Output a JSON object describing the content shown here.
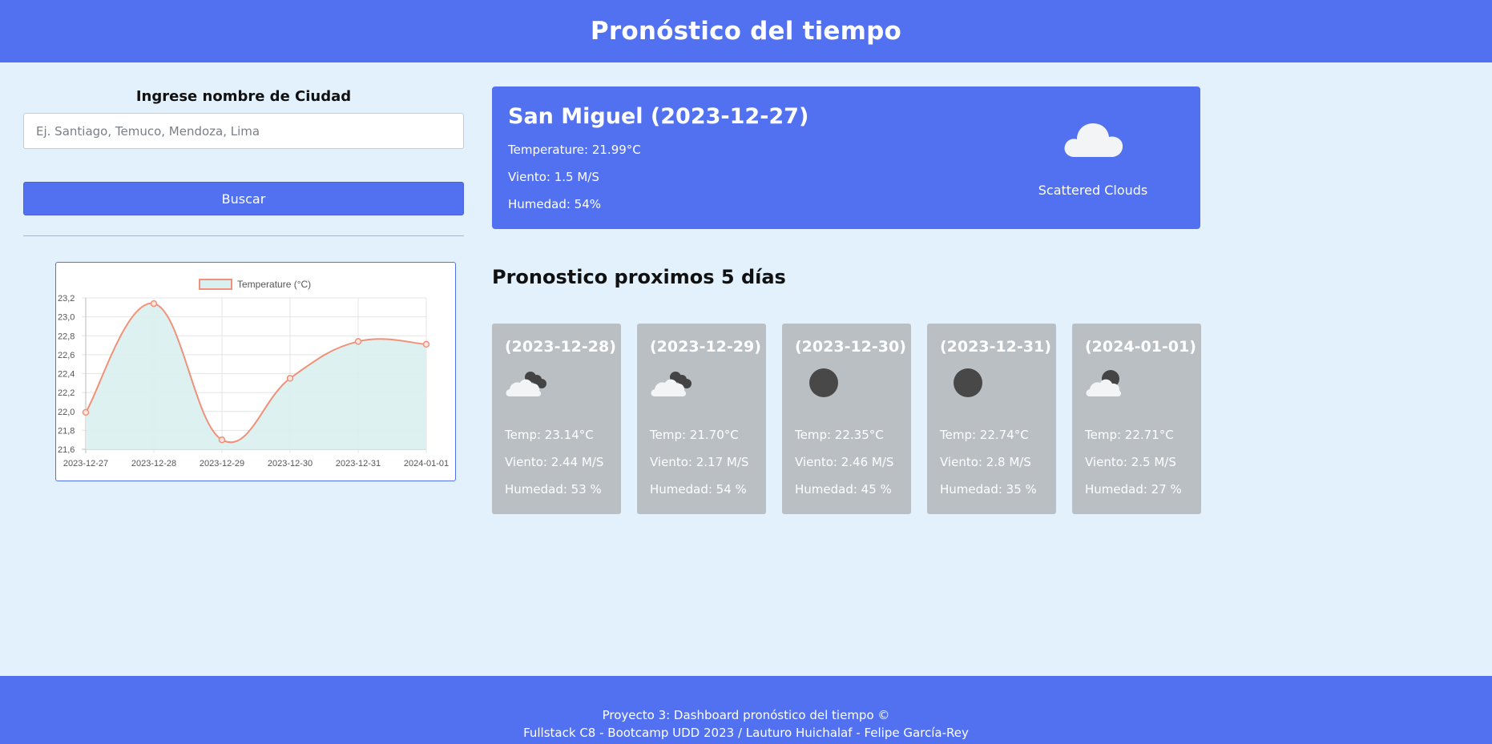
{
  "header": {
    "title": "Pronóstico del tiempo"
  },
  "search": {
    "label": "Ingrese nombre de Ciudad",
    "placeholder": "Ej. Santiago, Temuco, Mendoza, Lima",
    "button_label": "Buscar"
  },
  "current": {
    "title": "San Miguel (2023-12-27)",
    "temperature": "Temperature: 21.99°C",
    "wind": "Viento: 1.5 M/S",
    "humidity": "Humedad: 54%",
    "description": "Scattered Clouds",
    "icon": "cloud-icon"
  },
  "forecast": {
    "title": "Pronostico proximos 5 días",
    "days": [
      {
        "date": "(2023-12-28)",
        "icon": "cloud-night-icon",
        "temp": "Temp: 23.14°C",
        "wind": "Viento: 2.44 M/S",
        "humidity": "Humedad: 53 %"
      },
      {
        "date": "(2023-12-29)",
        "icon": "cloud-night-icon",
        "temp": "Temp: 21.70°C",
        "wind": "Viento: 2.17 M/S",
        "humidity": "Humedad: 54 %"
      },
      {
        "date": "(2023-12-30)",
        "icon": "moon-icon",
        "temp": "Temp: 22.35°C",
        "wind": "Viento: 2.46 M/S",
        "humidity": "Humedad: 45 %"
      },
      {
        "date": "(2023-12-31)",
        "icon": "moon-icon",
        "temp": "Temp: 22.74°C",
        "wind": "Viento: 2.8 M/S",
        "humidity": "Humedad: 35 %"
      },
      {
        "date": "(2024-01-01)",
        "icon": "cloud-moon-icon",
        "temp": "Temp: 22.71°C",
        "wind": "Viento: 2.5 M/S",
        "humidity": "Humedad: 27 %"
      }
    ]
  },
  "chart_data": {
    "type": "line",
    "title": "",
    "xlabel": "",
    "ylabel": "",
    "categories": [
      "2023-12-27",
      "2023-12-28",
      "2023-12-29",
      "2023-12-30",
      "2023-12-31",
      "2024-01-01"
    ],
    "series": [
      {
        "name": "Temperature (°C)",
        "values": [
          21.99,
          23.14,
          21.7,
          22.35,
          22.74,
          22.71
        ]
      }
    ],
    "ylim": [
      21.6,
      23.2
    ],
    "yticks": [
      "21,6",
      "21,8",
      "22,0",
      "22,2",
      "22,4",
      "22,6",
      "22,8",
      "23,0",
      "23,2"
    ],
    "fill": true,
    "grid": true,
    "legend_position": "top",
    "line_color": "#f0917a",
    "fill_color": "#daf0f0"
  },
  "footer": {
    "line1": "Proyecto 3: Dashboard pronóstico del tiempo ©",
    "line2": "Fullstack C8 - Bootcamp UDD 2023 / Lauturo Huichalaf - Felipe García-Rey"
  },
  "colors": {
    "brand": "#5271f0",
    "background": "#e2f1fb",
    "card_gray": "#babfc4"
  }
}
